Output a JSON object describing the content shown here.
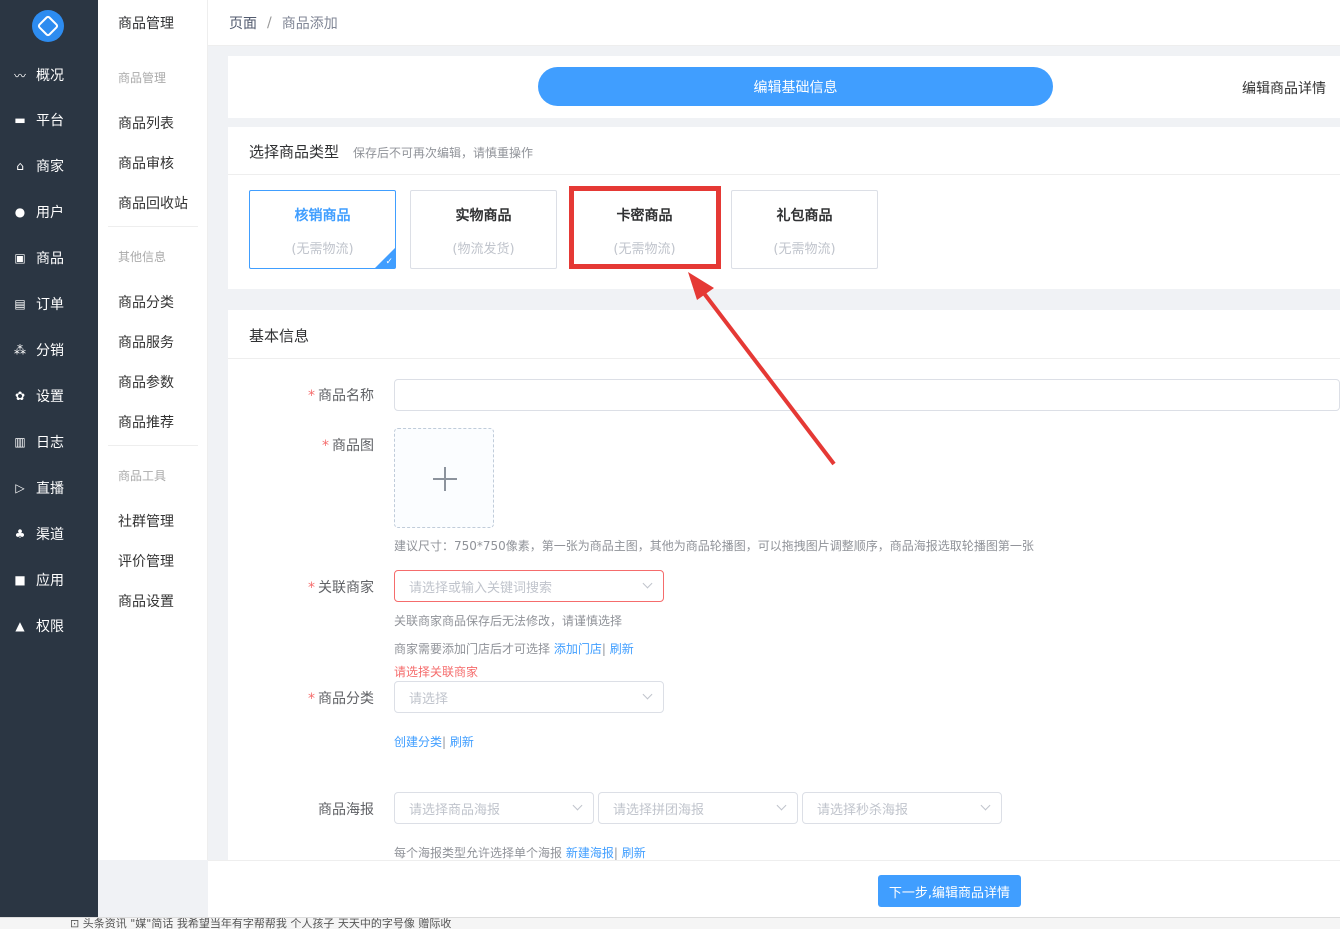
{
  "rail": {
    "items": [
      {
        "label": "概况",
        "icon": "chart-icon"
      },
      {
        "label": "平台",
        "icon": "monitor-icon"
      },
      {
        "label": "商家",
        "icon": "shop-icon"
      },
      {
        "label": "用户",
        "icon": "user-icon"
      },
      {
        "label": "商品",
        "icon": "bag-icon"
      },
      {
        "label": "订单",
        "icon": "order-icon"
      },
      {
        "label": "分销",
        "icon": "share-icon"
      },
      {
        "label": "设置",
        "icon": "gear-icon"
      },
      {
        "label": "日志",
        "icon": "log-icon"
      },
      {
        "label": "直播",
        "icon": "live-icon"
      },
      {
        "label": "渠道",
        "icon": "channel-icon"
      },
      {
        "label": "应用",
        "icon": "apps-icon"
      },
      {
        "label": "权限",
        "icon": "lock-icon"
      }
    ]
  },
  "submenu": {
    "title": "商品管理",
    "group1": "商品管理",
    "items1": [
      "商品列表",
      "商品审核",
      "商品回收站"
    ],
    "group2": "其他信息",
    "items2": [
      "商品分类",
      "商品服务",
      "商品参数",
      "商品推荐"
    ],
    "group3": "商品工具",
    "items3": [
      "社群管理",
      "评价管理",
      "商品设置"
    ]
  },
  "breadcrumb": {
    "root": "页面",
    "sep": "/",
    "current": "商品添加"
  },
  "steps": {
    "active": "编辑基础信息",
    "next": "编辑商品详情"
  },
  "type_section": {
    "title": "选择商品类型",
    "hint": "保存后不可再次编辑，请慎重操作",
    "cards": [
      {
        "name": "核销商品",
        "desc": "(无需物流)"
      },
      {
        "name": "实物商品",
        "desc": "(物流发货)"
      },
      {
        "name": "卡密商品",
        "desc": "(无需物流)"
      },
      {
        "name": "礼包商品",
        "desc": "(无需物流)"
      }
    ],
    "selected_index": 0,
    "highlighted_index": 2
  },
  "basic": {
    "title": "基本信息",
    "req": "*",
    "name_label": "商品名称",
    "name_value": "",
    "image_label": "商品图",
    "image_tip": "建议尺寸：750*750像素，第一张为商品主图，其他为商品轮播图，可以拖拽图片调整顺序，商品海报选取轮播图第一张",
    "merchant_label": "关联商家",
    "merchant_placeholder": "请选择或输入关键词搜索",
    "merchant_tip1": "关联商家商品保存后无法修改，请谨慎选择",
    "merchant_tip2": "商家需要添加门店后才可选择",
    "add_store_link": "添加门店",
    "refresh_link": "刷新",
    "pipe": "|",
    "merchant_error": "请选择关联商家",
    "category_label": "商品分类",
    "category_placeholder": "请选择",
    "create_category_link": "创建分类",
    "poster_label": "商品海报",
    "poster_placeholders": [
      "请选择商品海报",
      "请选择拼团海报",
      "请选择秒杀海报"
    ],
    "poster_tip": "每个海报类型允许选择单个海报",
    "new_poster_link": "新建海报"
  },
  "footer": {
    "next_button": "下一步,编辑商品详情"
  },
  "status_bar": "⊡ 头条资讯    \"媒\"简话    我希望当年有字帮帮我    个人孩子    天天中的字号像    赠际收"
}
